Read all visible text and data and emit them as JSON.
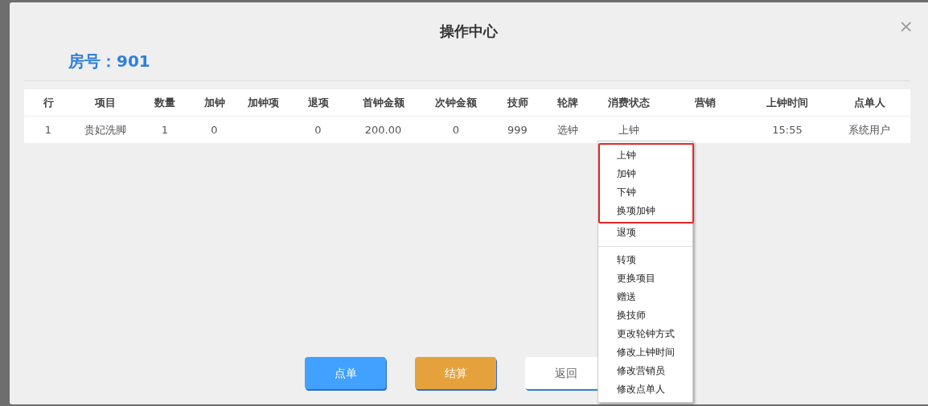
{
  "dialog": {
    "title": "操作中心",
    "close": "×",
    "room_label": "房号：901"
  },
  "table": {
    "columns": [
      "行",
      "项目",
      "数量",
      "加钟",
      "加钟项",
      "退项",
      "首钟金额",
      "次钟金额",
      "技师",
      "轮牌",
      "消费状态",
      "营销",
      "上钟时间",
      "点单人"
    ],
    "rows": [
      [
        "1",
        "贵妃洗脚",
        "1",
        "0",
        "",
        "0",
        "200.00",
        "0",
        "999",
        "选钟",
        "上钟",
        "",
        "15:55",
        "系统用户"
      ]
    ]
  },
  "buttons": [
    {
      "label": "点单",
      "kind": "primary"
    },
    {
      "label": "结算",
      "kind": "warning"
    },
    {
      "label": "返回",
      "kind": "default"
    }
  ],
  "context_menu": {
    "sections": [
      {
        "highlighted": true,
        "separated": false,
        "items": [
          "上钟",
          "加钟",
          "下钟",
          "换项加钟"
        ]
      },
      {
        "highlighted": false,
        "separated": false,
        "items": [
          "退项"
        ]
      },
      {
        "highlighted": false,
        "separated": true,
        "items": [
          "转项",
          "更换项目",
          "赠送",
          "换技师",
          "更改轮钟方式",
          "修改上钟时间",
          "修改营销员",
          "修改点单人"
        ]
      }
    ]
  }
}
